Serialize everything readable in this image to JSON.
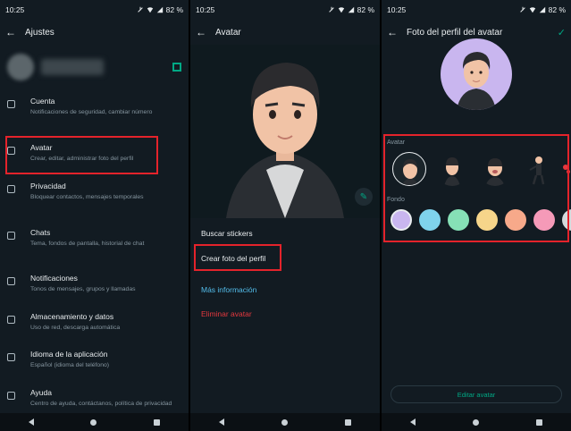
{
  "status": {
    "time": "10:25",
    "battery": "82 %"
  },
  "panel1": {
    "title": "Ajustes",
    "items": [
      {
        "title": "Cuenta",
        "sub": "Notificaciones de seguridad, cambiar número",
        "icon": "key-icon"
      },
      {
        "title": "Avatar",
        "sub": "Crear, editar, administrar foto del perfil",
        "icon": "avatar-icon"
      },
      {
        "title": "Privacidad",
        "sub": "Bloquear contactos, mensajes temporales",
        "icon": "lock-icon"
      },
      {
        "title": "Chats",
        "sub": "Tema, fondos de pantalla, historial de chat",
        "icon": "chat-icon"
      },
      {
        "title": "Notificaciones",
        "sub": "Tonos de mensajes, grupos y llamadas",
        "icon": "bell-icon"
      },
      {
        "title": "Almacenamiento y datos",
        "sub": "Uso de red, descarga automática",
        "icon": "storage-icon"
      },
      {
        "title": "Idioma de la aplicación",
        "sub": "Español (idioma del teléfono)",
        "icon": "globe-icon"
      },
      {
        "title": "Ayuda",
        "sub": "Centro de ayuda, contáctanos, política de privacidad",
        "icon": "help-icon"
      }
    ]
  },
  "panel2": {
    "title": "Avatar",
    "items": {
      "stickers": "Buscar stickers",
      "create": "Crear foto del perfil",
      "more": "Más información",
      "delete": "Eliminar avatar"
    }
  },
  "panel3": {
    "title": "Foto del perfil del avatar",
    "avatar_label": "Avatar",
    "fondo_label": "Fondo",
    "edit": "Editar avatar",
    "swatches": [
      "#c9b6ef",
      "#7fd3ec",
      "#86e0b6",
      "#f6d58a",
      "#f7a98a",
      "#f59ab8",
      "#d5dadc"
    ]
  },
  "colors": {
    "accent": "#00a884",
    "danger": "#e5383e",
    "link": "#53bdeb",
    "highlight": "#e4232b"
  }
}
